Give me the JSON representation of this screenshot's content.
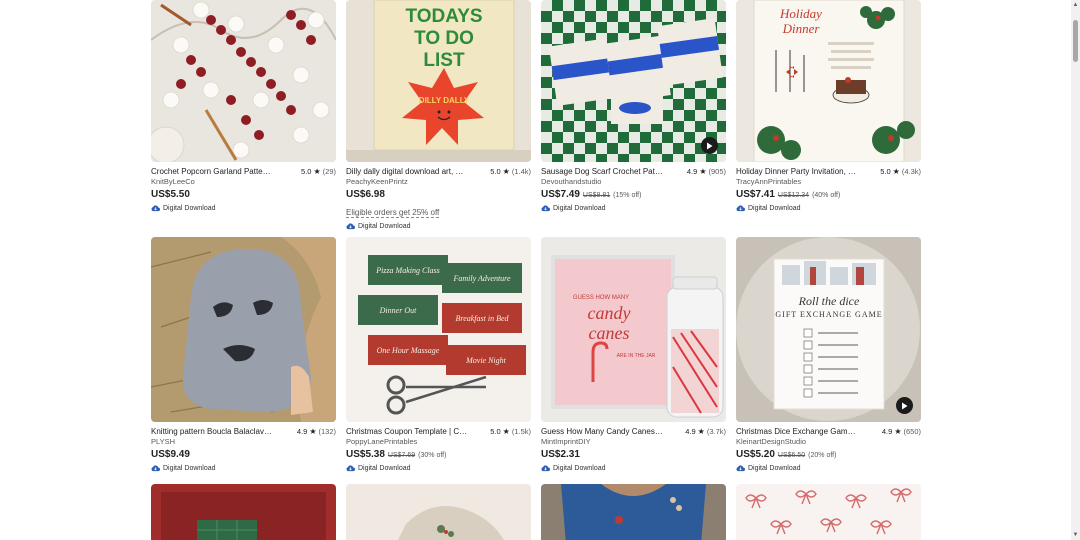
{
  "listings": [
    {
      "title": "Crochet Popcorn Garland Patter…",
      "rating": "5.0",
      "count": "(29)",
      "shop": "KnitByLeeCo",
      "price": "US$5.50",
      "original": "",
      "discount": "",
      "promo": "",
      "download": "Digital Download",
      "video": false
    },
    {
      "title": "Dilly dally digital download art, …",
      "rating": "5.0",
      "count": "(1.4k)",
      "shop": "PeachyKeenPrintz",
      "price": "US$6.98",
      "original": "",
      "discount": "",
      "promo": "Eligible orders get 25% off",
      "download": "Digital Download",
      "video": false
    },
    {
      "title": "Sausage Dog Scarf Crochet Patt…",
      "rating": "4.9",
      "count": "(905)",
      "shop": "Devouthandstudio",
      "price": "US$7.49",
      "original": "US$8.81",
      "discount": "(15% off)",
      "promo": "",
      "download": "Digital Download",
      "video": true
    },
    {
      "title": "Holiday Dinner Party Invitation, …",
      "rating": "5.0",
      "count": "(4.3k)",
      "shop": "TracyAnnPrintables",
      "price": "US$7.41",
      "original": "US$12.34",
      "discount": "(40% off)",
      "promo": "",
      "download": "Digital Download",
      "video": false
    },
    {
      "title": "Knitting pattern Boucla Balaclav…",
      "rating": "4.9",
      "count": "(132)",
      "shop": "PLYSH",
      "price": "US$9.49",
      "original": "",
      "discount": "",
      "promo": "",
      "download": "Digital Download",
      "video": false
    },
    {
      "title": "Christmas Coupon Template | C…",
      "rating": "5.0",
      "count": "(1.5k)",
      "shop": "PoppyLanePrintables",
      "price": "US$5.38",
      "original": "US$7.69",
      "discount": "(30% off)",
      "promo": "",
      "download": "Digital Download",
      "video": false
    },
    {
      "title": "Guess How Many Candy Canes …",
      "rating": "4.9",
      "count": "(3.7k)",
      "shop": "MintImprintDIY",
      "price": "US$2.31",
      "original": "",
      "discount": "",
      "promo": "",
      "download": "Digital Download",
      "video": false
    },
    {
      "title": "Christmas Dice Exchange Game,…",
      "rating": "4.9",
      "count": "(650)",
      "shop": "KleinartDesignStudio",
      "price": "US$5.20",
      "original": "US$6.50",
      "discount": "(20% off)",
      "promo": "",
      "download": "Digital Download",
      "video": true
    }
  ],
  "thumb_text": {
    "todo_line1": "TODAYS",
    "todo_line2": "TO DO",
    "todo_line3": "LIST",
    "todo_star": "DILLY DALLY",
    "dinner_title1": "Holiday",
    "dinner_title2": "Dinner",
    "coupon_1": "Pizza Making Class",
    "coupon_2": "Family Adventure",
    "coupon_3": "Dinner Out",
    "coupon_4": "Breakfast in Bed",
    "coupon_5": "One Hour Massage",
    "coupon_6": "Movie Night",
    "candy_guess": "GUESS HOW MANY",
    "candy_1": "candy",
    "candy_2": "canes",
    "candy_jar": "ARE IN THE JAR",
    "dice_1": "Roll the dice",
    "dice_2": "GIFT EXCHANGE GAME"
  },
  "icons": {
    "star": "★",
    "play": "play-icon",
    "download": "cloud-download-icon"
  },
  "colors": {
    "text": "#222222",
    "muted": "#595959",
    "download_icon": "#2f5fb3",
    "play_bg": "#1b1b1b"
  }
}
